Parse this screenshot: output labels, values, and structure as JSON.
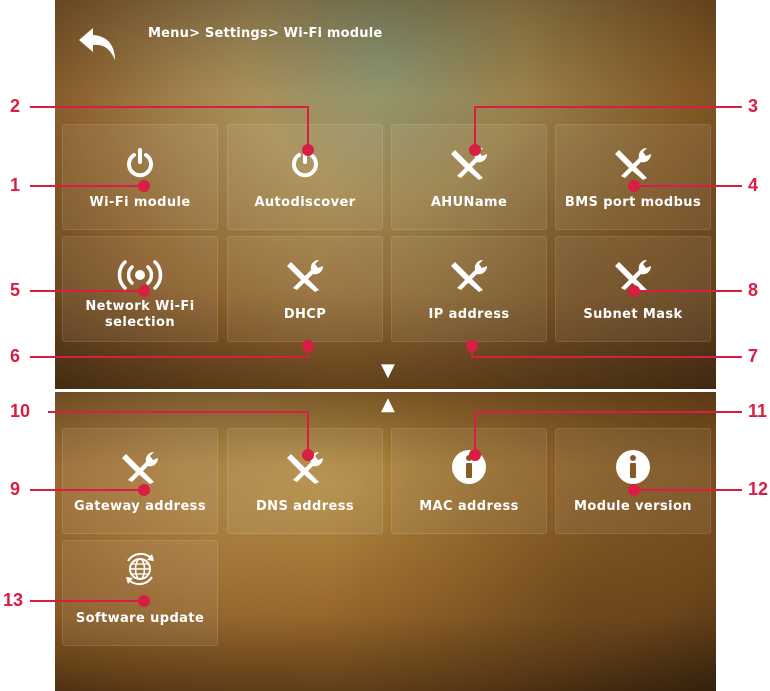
{
  "header": {
    "breadcrumb": "Menu> Settings> Wi-Fi module"
  },
  "tiles": [
    {
      "label": "Wi-Fi module",
      "icon": "power-icon"
    },
    {
      "label": "Autodiscover",
      "icon": "power-icon"
    },
    {
      "label": "AHUName",
      "icon": "tools-icon"
    },
    {
      "label": "BMS port modbus",
      "icon": "tools-icon"
    },
    {
      "label_line1": "Network Wi-Fi",
      "label_line2": "selection",
      "icon": "wireless-signal-icon"
    },
    {
      "label": "DHCP",
      "icon": "tools-icon"
    },
    {
      "label": "IP address",
      "icon": "tools-icon"
    },
    {
      "label": "Subnet Mask",
      "icon": "tools-icon"
    },
    {
      "label": "Gateway address",
      "icon": "tools-icon"
    },
    {
      "label": "DNS address",
      "icon": "tools-icon"
    },
    {
      "label": "MAC address",
      "icon": "info-icon"
    },
    {
      "label": "Module version",
      "icon": "info-icon"
    },
    {
      "label": "Software update",
      "icon": "globe-update-icon"
    }
  ],
  "callouts": [
    "1",
    "2",
    "3",
    "4",
    "5",
    "6",
    "7",
    "8",
    "9",
    "10",
    "11",
    "12",
    "13"
  ],
  "colors": {
    "callout": "#d81e42",
    "text": "#ffffff"
  }
}
